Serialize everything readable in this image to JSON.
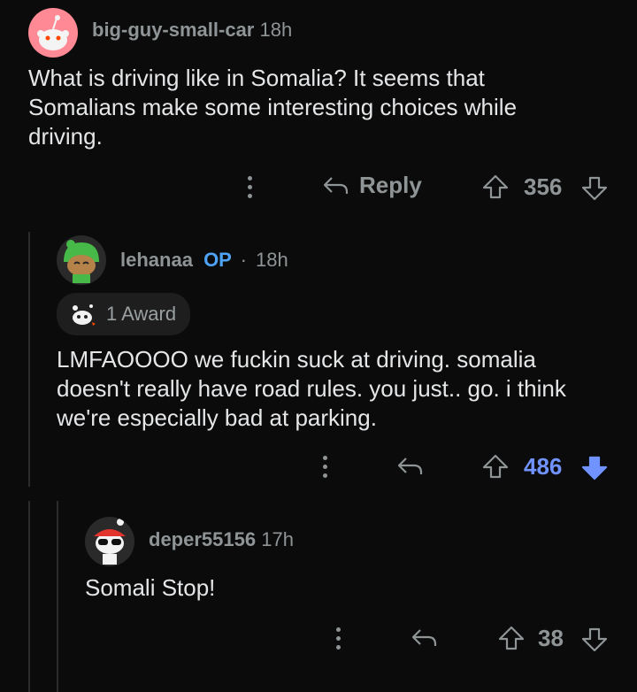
{
  "comments": [
    {
      "username": "big-guy-small-car",
      "time": "18h",
      "body": "What is driving like in Somalia? It seems that Somalians make some interesting choices while driving.",
      "reply_label": "Reply",
      "votes": "356"
    },
    {
      "username": "lehanaa",
      "op_badge": "OP",
      "separator": "·",
      "time": "18h",
      "award": "1 Award",
      "body": "LMFAOOOO we fuckin suck at driving. somalia doesn't really have road rules. you just.. go. i think we're especially bad at parking.",
      "votes": "486",
      "vote_state": "downvoted"
    },
    {
      "username": "deper55156",
      "time": "17h",
      "body": "Somali Stop!",
      "votes": "38"
    }
  ],
  "colors": {
    "background": "#0b0b0b",
    "text": "#e4e6e8",
    "muted": "#8f9496",
    "accent_blue": "#7193ff",
    "op_blue": "#4fa3f7"
  }
}
